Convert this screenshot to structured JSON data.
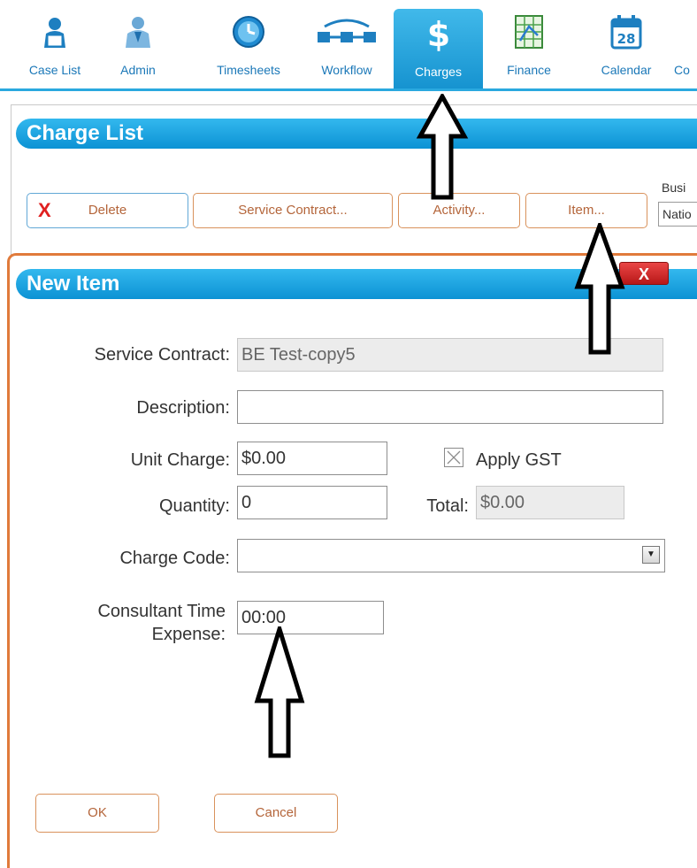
{
  "nav": {
    "items": [
      {
        "label": "Case List",
        "icon": "case-list-icon"
      },
      {
        "label": "Admin",
        "icon": "admin-icon"
      },
      {
        "label": "Timesheets",
        "icon": "clock-icon"
      },
      {
        "label": "Workflow",
        "icon": "workflow-icon"
      },
      {
        "label": "Charges",
        "icon": "dollar-icon"
      },
      {
        "label": "Finance",
        "icon": "spreadsheet-icon"
      },
      {
        "label": "Calendar",
        "icon": "calendar-icon",
        "day": "28"
      },
      {
        "label": "Co",
        "icon": "none"
      }
    ],
    "active": "Charges",
    "accent": "#2aa9df"
  },
  "charge_list": {
    "title": "Charge List",
    "buttons": {
      "delete": "Delete",
      "service_contract": "Service Contract...",
      "activity": "Activity...",
      "item": "Item..."
    },
    "business_label": "Busi",
    "business_value": "Natio"
  },
  "dialog": {
    "title": "New Item",
    "close": "X",
    "fields": {
      "service_contract_label": "Service Contract:",
      "service_contract_value": "BE  Test-copy5",
      "description_label": "Description:",
      "description_value": "",
      "unit_charge_label": "Unit Charge:",
      "unit_charge_value": "$0.00",
      "apply_gst_label": "Apply GST",
      "apply_gst_checked": true,
      "quantity_label": "Quantity:",
      "quantity_value": "0",
      "total_label": "Total:",
      "total_value": "$0.00",
      "charge_code_label": "Charge Code:",
      "charge_code_value": "",
      "consultant_time_label_1": "Consultant Time",
      "consultant_time_label_2": "Expense:",
      "consultant_time_value": "00:00"
    },
    "buttons": {
      "ok": "OK",
      "cancel": "Cancel"
    },
    "border_color": "#e07a3b"
  }
}
